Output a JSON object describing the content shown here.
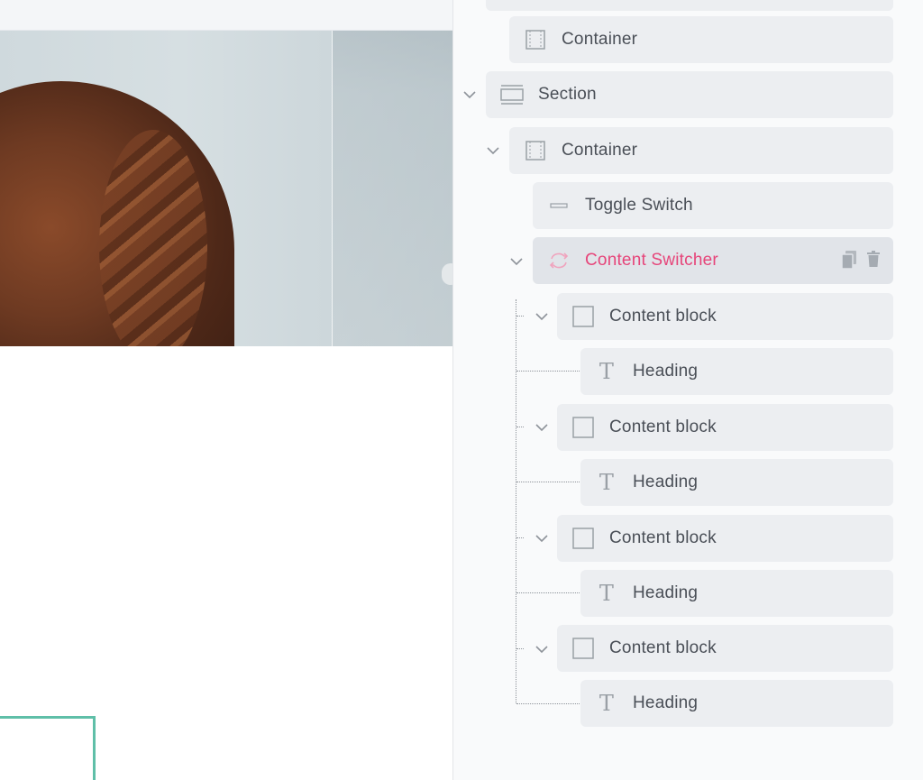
{
  "structure": {
    "rows": [
      {
        "label": "Container",
        "icon": "container-icon"
      },
      {
        "label": "Section",
        "icon": "section-icon"
      },
      {
        "label": "Container",
        "icon": "container-icon"
      },
      {
        "label": "Toggle Switch",
        "icon": "toggle-icon"
      },
      {
        "label": "Content Switcher",
        "icon": "switcher-icon"
      },
      {
        "label": "Content block",
        "icon": "block-icon"
      },
      {
        "label": "Heading",
        "icon": "text-icon"
      },
      {
        "label": "Content block",
        "icon": "block-icon"
      },
      {
        "label": "Heading",
        "icon": "text-icon"
      },
      {
        "label": "Content block",
        "icon": "block-icon"
      },
      {
        "label": "Heading",
        "icon": "text-icon"
      },
      {
        "label": "Content block",
        "icon": "block-icon"
      },
      {
        "label": "Heading",
        "icon": "text-icon"
      }
    ],
    "selected_index": 4
  },
  "colors": {
    "accent": "#e6457a",
    "row_bg": "#eceef1",
    "selected_bg": "#e1e4e9",
    "teal": "#5fbfa8"
  }
}
